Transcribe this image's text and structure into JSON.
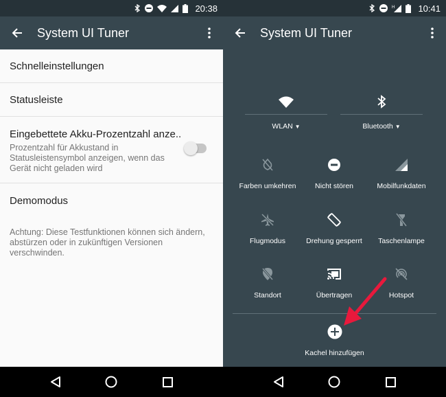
{
  "left": {
    "status": {
      "time": "20:38"
    },
    "appbar": {
      "title": "System UI Tuner"
    },
    "rows": {
      "quick_settings": "Schnelleinstellungen",
      "status_bar": "Statusleiste",
      "battery_title": "Eingebettete Akku-Prozentzahl anze..",
      "battery_summary": "Prozentzahl für Akkustand in Statusleistensymbol anzeigen, wenn das Gerät nicht geladen wird",
      "battery_toggle_on": false,
      "demo_mode": "Demomodus"
    },
    "note": "Achtung: Diese Testfunktionen können sich ändern, abstürzen oder in zukünftigen Versionen verschwinden."
  },
  "right": {
    "status": {
      "time": "10:41"
    },
    "appbar": {
      "title": "System UI Tuner"
    },
    "big_tiles": {
      "wifi": "WLAN",
      "bluetooth": "Bluetooth"
    },
    "tiles": {
      "invert": "Farben umkehren",
      "dnd": "Nicht stören",
      "mobile": "Mobilfunkdaten",
      "airplane": "Flugmodus",
      "rotation": "Drehung gesperrt",
      "flashlight": "Taschenlampe",
      "location": "Standort",
      "cast": "Übertragen",
      "hotspot": "Hotspot"
    },
    "add_tile": "Kachel hinzufügen"
  },
  "colors": {
    "appbar": "#37474f",
    "statusbar": "#263238",
    "arrow": "#e8193c"
  },
  "icons": [
    "arrow-back-icon",
    "more-vert-icon",
    "wifi-icon",
    "bluetooth-icon",
    "invert-colors-icon",
    "do-not-disturb-icon",
    "signal-icon",
    "airplane-icon",
    "screen-rotation-icon",
    "flashlight-icon",
    "location-icon",
    "cast-icon",
    "hotspot-icon",
    "add-circle-icon"
  ]
}
